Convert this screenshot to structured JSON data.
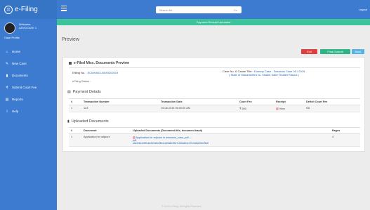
{
  "brand": {
    "name": "e-Filing",
    "logo_icon": "scales-icon"
  },
  "profile": {
    "welcome": "Welcome",
    "username": "ADVOCATE 1",
    "role": "Case Profile"
  },
  "sidebar": {
    "items": [
      {
        "label": "Home",
        "icon": "home-icon",
        "glyph": "⌂"
      },
      {
        "label": "New Case",
        "icon": "new-case-icon",
        "glyph": "✎"
      },
      {
        "label": "Documents",
        "icon": "documents-icon",
        "glyph": "▮"
      },
      {
        "label": "Submit Court Fee",
        "icon": "court-fee-icon",
        "glyph": "₹"
      },
      {
        "label": "Reports",
        "icon": "reports-icon",
        "glyph": "▤"
      },
      {
        "label": "Help",
        "icon": "help-icon",
        "glyph": "i"
      }
    ]
  },
  "topbar": {
    "search_placeholder": "Search for...",
    "search_go": "Go",
    "logout": "Logout"
  },
  "banner": {
    "text": "Payment Receipt Uploaded"
  },
  "main": {
    "title": "Preview",
    "buttons": {
      "exit": "Exit",
      "final_submit": "Final Submit",
      "back": "Back"
    }
  },
  "card": {
    "title": "e-Filed Misc. Documents Preview",
    "efiling_no_label": "Efiling No. :",
    "efiling_no": "ECMHA03-000002/2019",
    "case_label": "Case No. & Cause Title :",
    "case_value": "Dummy Case - Sessions Case 00 / 2019",
    "case_sub": "( State of Maharashtra vs. Shaikh Salim Shaikh Rasool )",
    "efiling_status": "eFiling Status :",
    "payment_title": "Payment Details",
    "payment": {
      "headers": [
        "#",
        "Transaction Number",
        "Transaction Date",
        "Court Fee",
        "Receipt",
        "Deficit Court Fee"
      ],
      "rows": [
        {
          "idx": "1",
          "txn": "123",
          "date": "19-06-2019 06:00:00 AM",
          "fee": "₹ 500",
          "receipt": "View",
          "deficit": "NA"
        }
      ]
    },
    "docs_title": "Uploaded Documents",
    "docs": {
      "headers": [
        "#",
        "Document",
        "Uploaded Documents (Document title, document hash)",
        "Pages"
      ],
      "rows": [
        {
          "idx": "1",
          "doc": "Application for adjourn",
          "file": "Application for adjourn in sessions_case_pdf....",
          "line2": "pdf",
          "hash": "a4d2e8c1b9f0c6e3d7a5b2f8e4c1d9a6b3f0e7c2d5a8b1e4f7c0d3a6b9e2f5c8",
          "pages": "4"
        }
      ]
    }
  },
  "footer": {
    "text": "© 2019 e-Filing. All Rights Reserved."
  }
}
